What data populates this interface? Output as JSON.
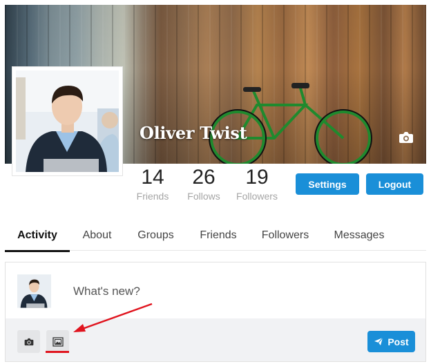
{
  "profile": {
    "name": "Oliver Twist"
  },
  "stats": [
    {
      "value": "14",
      "label": "Friends"
    },
    {
      "value": "26",
      "label": "Follows"
    },
    {
      "value": "19",
      "label": "Followers"
    }
  ],
  "actions": {
    "settings_label": "Settings",
    "logout_label": "Logout"
  },
  "tabs": [
    {
      "label": "Activity",
      "active": true
    },
    {
      "label": "About"
    },
    {
      "label": "Groups"
    },
    {
      "label": "Friends"
    },
    {
      "label": "Followers"
    },
    {
      "label": "Messages"
    }
  ],
  "composer": {
    "placeholder": "What's new?",
    "post_label": "Post",
    "icons": [
      "camera-icon",
      "image-frame-icon",
      "send-icon"
    ]
  },
  "colors": {
    "accent": "#1a8fd8",
    "annotation": "#e0141e"
  }
}
